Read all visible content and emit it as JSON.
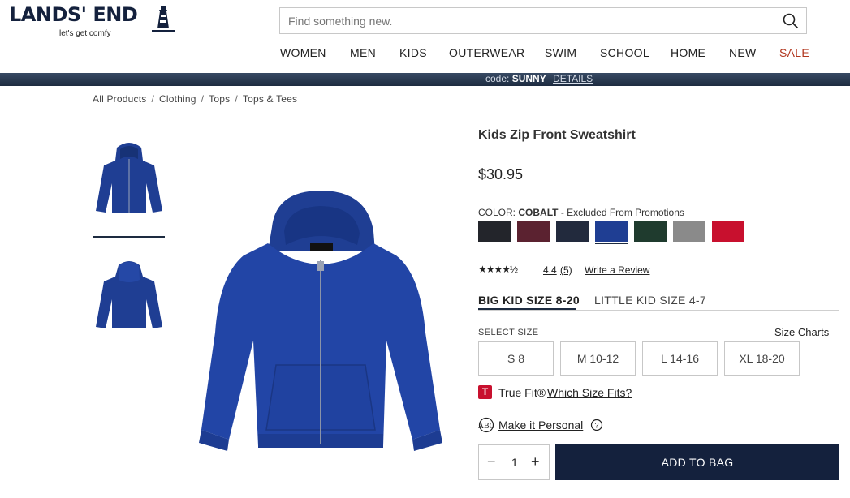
{
  "brand": {
    "name": "LANDS' END",
    "tagline": "let's get comfy"
  },
  "search": {
    "placeholder": "Find something new."
  },
  "nav": {
    "items": [
      "WOMEN",
      "MEN",
      "KIDS",
      "OUTERWEAR",
      "SWIM",
      "SCHOOL",
      "HOME",
      "NEW",
      "SALE"
    ]
  },
  "promo": {
    "prefix": "code:",
    "code": "SUNNY",
    "details": "DETAILS"
  },
  "breadcrumb": [
    "All Products",
    "Clothing",
    "Tops",
    "Tops & Tees"
  ],
  "product": {
    "title": "Kids Zip Front Sweatshirt",
    "price": "$30.95",
    "color_label": "COLOR:",
    "color_name": "COBALT",
    "color_note": "- Excluded From Promotions",
    "swatches": [
      {
        "name": "black",
        "hex": "#23252b"
      },
      {
        "name": "burgundy",
        "hex": "#5b2230"
      },
      {
        "name": "navy",
        "hex": "#222a3d"
      },
      {
        "name": "cobalt",
        "hex": "#1f3e93",
        "selected": true
      },
      {
        "name": "evergreen",
        "hex": "#1f3b2e"
      },
      {
        "name": "gray heather",
        "hex": "#8a8a8a"
      },
      {
        "name": "red",
        "hex": "#c8102e"
      }
    ],
    "rating": {
      "stars": "★★★★½",
      "value": "4.4",
      "count": "(5)",
      "write_review": "Write a Review",
      "score": 4.4
    },
    "size_tabs": [
      "BIG KID SIZE 8-20",
      "LITTLE KID SIZE 4-7"
    ],
    "select_size_label": "SELECT SIZE",
    "size_charts": "Size Charts",
    "sizes": [
      "S 8",
      "M 10-12",
      "L 14-16",
      "XL 18-20"
    ],
    "truefit": {
      "logo": "T",
      "label": "True Fit®",
      "link": "Which Size Fits?"
    },
    "personal": "Make it Personal",
    "quantity": "1",
    "add_to_bag": "ADD TO BAG"
  },
  "colors": {
    "navy_brand": "#14213d",
    "sale": "#b1361e",
    "cobalt": "#1f3e93"
  }
}
